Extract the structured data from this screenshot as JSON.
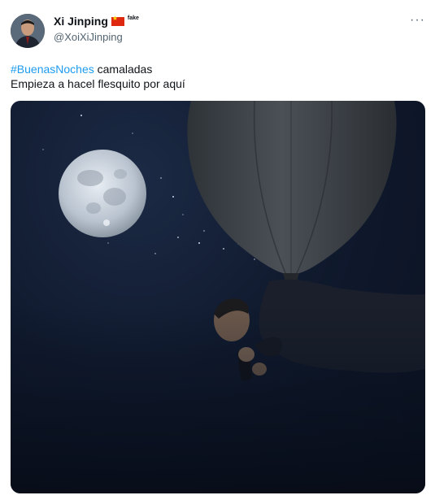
{
  "author": {
    "display_name": "Xi Jinping",
    "badge": "fake",
    "handle": "@XoiXiJinping"
  },
  "tweet": {
    "hashtag": "#BuenasNoches",
    "line1_rest": " camaladas",
    "line2": "Empieza a hacel flesquito por aquí"
  },
  "menu": {
    "more_glyph": "···"
  },
  "colors": {
    "link": "#1d9bf0",
    "sky": "#0a1120",
    "balloon": "#3a3f45",
    "moon": "#c9d1dc"
  }
}
